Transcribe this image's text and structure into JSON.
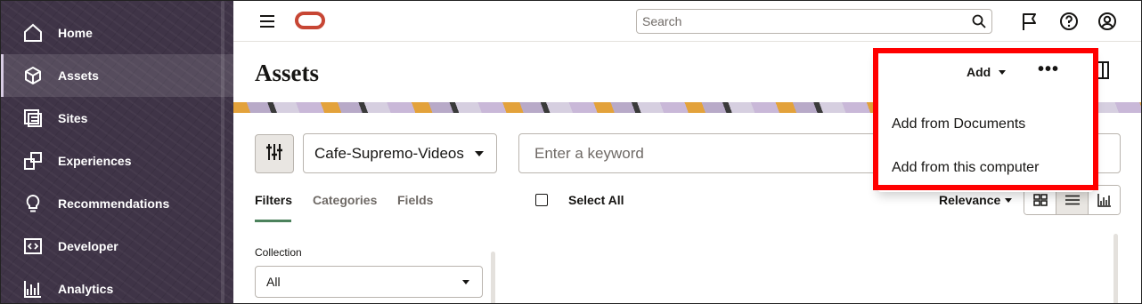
{
  "sidebar": {
    "items": [
      {
        "label": "Home",
        "icon": "home-icon"
      },
      {
        "label": "Assets",
        "icon": "cube-icon",
        "active": true
      },
      {
        "label": "Sites",
        "icon": "sites-icon"
      },
      {
        "label": "Experiences",
        "icon": "experiences-icon"
      },
      {
        "label": "Recommendations",
        "icon": "lightbulb-icon"
      },
      {
        "label": "Developer",
        "icon": "code-icon"
      },
      {
        "label": "Analytics",
        "icon": "analytics-icon"
      }
    ]
  },
  "header": {
    "search_placeholder": "Search"
  },
  "page": {
    "title": "Assets"
  },
  "toolbar": {
    "repository": "Cafe-Supremo-Videos",
    "keyword_placeholder": "Enter a keyword",
    "tabs": [
      "Filters",
      "Categories",
      "Fields"
    ],
    "select_all": "Select All",
    "sort": "Relevance"
  },
  "filters": {
    "collection_label": "Collection",
    "collection_value": "All"
  },
  "menu": {
    "add_label": "Add",
    "more_label": "•••",
    "items": [
      "Add from Documents",
      "Add from this computer"
    ]
  },
  "colors": {
    "sidebar_bg": "#3f3447",
    "brand": "#c74634",
    "highlight": "#ff0000",
    "tab_accent": "#4c825c"
  }
}
